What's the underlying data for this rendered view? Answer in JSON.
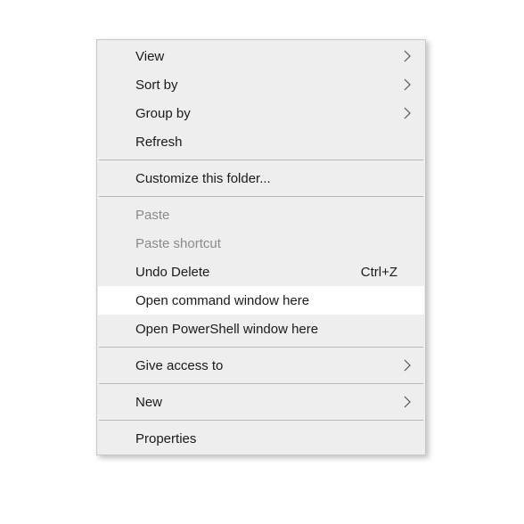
{
  "menu": {
    "items": [
      {
        "id": "view",
        "label": "View",
        "submenu": true
      },
      {
        "id": "sort-by",
        "label": "Sort by",
        "submenu": true
      },
      {
        "id": "group-by",
        "label": "Group by",
        "submenu": true
      },
      {
        "id": "refresh",
        "label": "Refresh"
      },
      {
        "separator": true
      },
      {
        "id": "customize-folder",
        "label": "Customize this folder..."
      },
      {
        "separator": true
      },
      {
        "id": "paste",
        "label": "Paste",
        "disabled": true
      },
      {
        "id": "paste-shortcut",
        "label": "Paste shortcut",
        "disabled": true
      },
      {
        "id": "undo-delete",
        "label": "Undo Delete",
        "shortcut": "Ctrl+Z"
      },
      {
        "id": "open-command-window",
        "label": "Open command window here",
        "highlight": true
      },
      {
        "id": "open-powershell",
        "label": "Open PowerShell window here"
      },
      {
        "separator": true
      },
      {
        "id": "give-access-to",
        "label": "Give access to",
        "submenu": true
      },
      {
        "separator": true
      },
      {
        "id": "new",
        "label": "New",
        "submenu": true
      },
      {
        "separator": true
      },
      {
        "id": "properties",
        "label": "Properties"
      }
    ]
  }
}
